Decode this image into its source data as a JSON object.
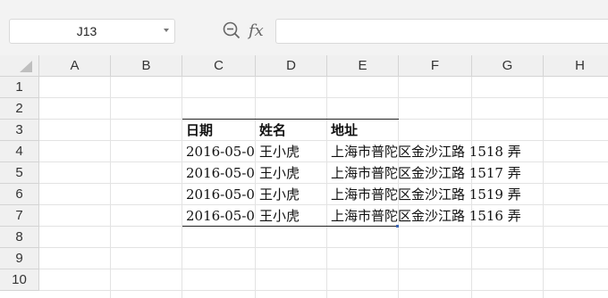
{
  "name_box": {
    "value": "J13"
  },
  "formula_bar": {
    "fx_label": "fx",
    "content": ""
  },
  "columns": [
    "A",
    "B",
    "C",
    "D",
    "E",
    "F",
    "G",
    "H"
  ],
  "rows": [
    "1",
    "2",
    "3",
    "4",
    "5",
    "6",
    "7",
    "8",
    "9",
    "10"
  ],
  "table": {
    "headers": [
      "日期",
      "姓名",
      "地址"
    ],
    "rows": [
      [
        "2016-05-0",
        "王小虎",
        "上海市普陀区金沙江路 1518 弄"
      ],
      [
        "2016-05-0",
        "王小虎",
        "上海市普陀区金沙江路 1517 弄"
      ],
      [
        "2016-05-0",
        "王小虎",
        "上海市普陀区金沙江路 1519 弄"
      ],
      [
        "2016-05-0",
        "王小虎",
        "上海市普陀区金沙江路 1516 弄"
      ]
    ]
  },
  "icons": {
    "zoom": "zoom-magnifier-icon",
    "namebox_dropdown": "chevron-down-icon"
  }
}
